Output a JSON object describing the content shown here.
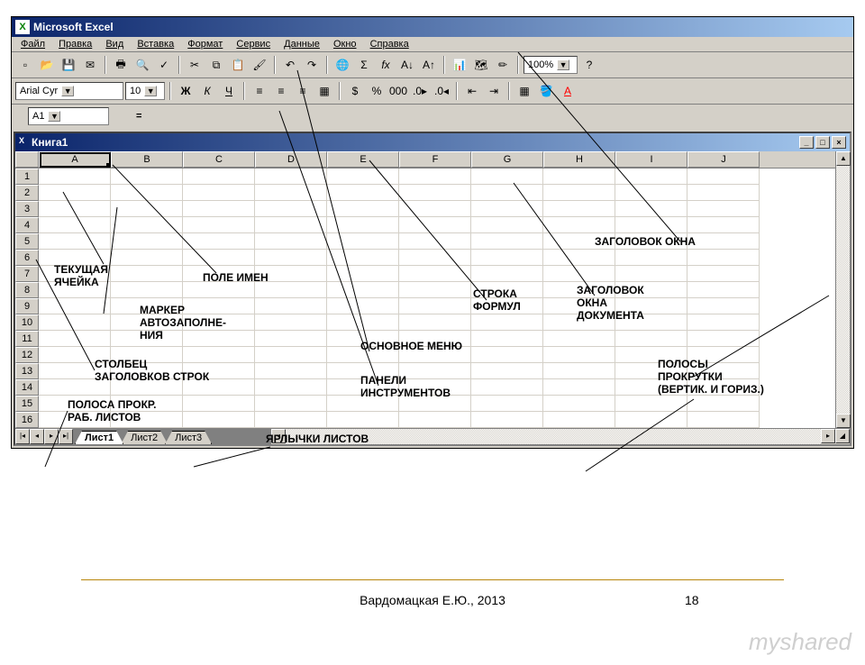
{
  "app": {
    "title": "Microsoft Excel",
    "menu": [
      "Файл",
      "Правка",
      "Вид",
      "Вставка",
      "Формат",
      "Сервис",
      "Данные",
      "Окно",
      "Справка"
    ],
    "font": {
      "name": "Arial Cyr",
      "size": "10"
    },
    "zoom": "100%",
    "namebox": "A1",
    "doc_title": "Книга1",
    "cols": [
      "A",
      "B",
      "C",
      "D",
      "E",
      "F",
      "G",
      "H",
      "I",
      "J"
    ],
    "rows": [
      "1",
      "2",
      "3",
      "4",
      "5",
      "6",
      "7",
      "8",
      "9",
      "10",
      "11",
      "12",
      "13",
      "14",
      "15",
      "16"
    ],
    "tabs": [
      "Лист1",
      "Лист2",
      "Лист3"
    ],
    "bold": "Ж",
    "italic": "К",
    "underline": "Ч",
    "sigma": "Σ",
    "fx": "fx",
    "percent": "%",
    "currency": "$"
  },
  "annotations": {
    "current_cell": "ТЕКУЩАЯ\nЯЧЕЙКА",
    "fill_marker": "МАРКЕР\nАВТОЗАПОЛНЕ-\nНИЯ",
    "rowhead_col": "СТОЛБЕЦ\nЗАГОЛОВКОВ СТРОК",
    "sheet_scroll": "ПОЛОСА ПРОКР.\nРАБ. ЛИСТОВ",
    "sheet_tabs": "ЯРЛЫЧКИ ЛИСТОВ",
    "namebox_label": "ПОЛЕ ИМЕН",
    "main_menu": "ОСНОВНОЕ МЕНЮ",
    "toolbars": "ПАНЕЛИ\nИНСТРУМЕНТОВ",
    "formula_bar": "СТРОКА\nФОРМУЛ",
    "doc_title_label": "ЗАГОЛОВОК\nОКНА\nДОКУМЕНТА",
    "win_title": "ЗАГОЛОВОК ОКНА",
    "scrollbars": "ПОЛОСЫ\nПРОКРУТКИ\n(ВЕРТИК. И ГОРИЗ.)"
  },
  "footer": {
    "author": "Вардомацкая Е.Ю., 2013",
    "page": "18",
    "watermark": "myshared"
  }
}
